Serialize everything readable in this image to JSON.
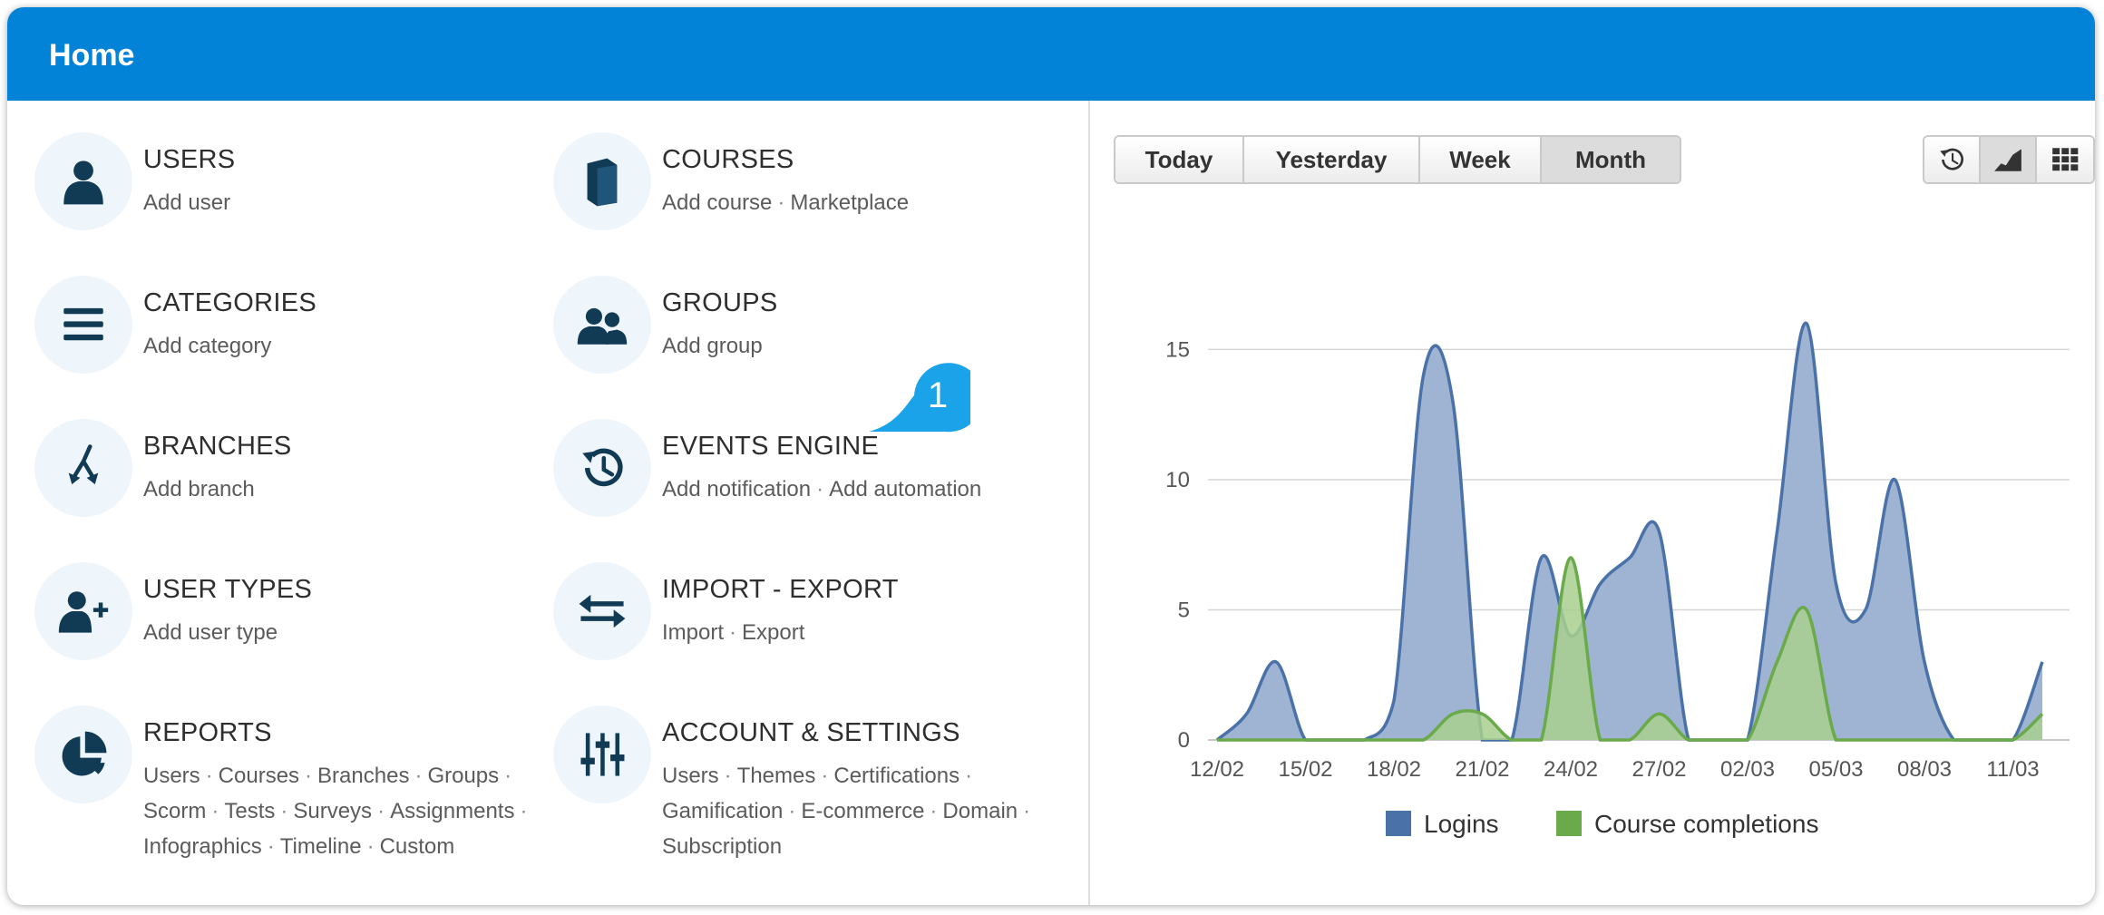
{
  "header": {
    "title": "Home"
  },
  "menu": [
    {
      "id": "users",
      "icon": "user-icon",
      "title": "USERS",
      "links": [
        [
          "Add user"
        ]
      ]
    },
    {
      "id": "courses",
      "icon": "book-icon",
      "title": "COURSES",
      "links": [
        [
          "Add course",
          "Marketplace"
        ]
      ]
    },
    {
      "id": "categories",
      "icon": "list-icon",
      "title": "CATEGORIES",
      "links": [
        [
          "Add category"
        ]
      ]
    },
    {
      "id": "groups",
      "icon": "group-icon",
      "title": "GROUPS",
      "links": [
        [
          "Add group"
        ]
      ]
    },
    {
      "id": "branches",
      "icon": "branch-icon",
      "title": "BRANCHES",
      "links": [
        [
          "Add branch"
        ]
      ]
    },
    {
      "id": "events-engine",
      "icon": "history-icon",
      "title": "EVENTS ENGINE",
      "links": [
        [
          "Add notification",
          "Add automation"
        ]
      ]
    },
    {
      "id": "user-types",
      "icon": "add-user-icon",
      "title": "USER TYPES",
      "links": [
        [
          "Add user type"
        ]
      ]
    },
    {
      "id": "import-export",
      "icon": "swap-arrows-icon",
      "title": "IMPORT - EXPORT",
      "links": [
        [
          "Import",
          "Export"
        ]
      ]
    },
    {
      "id": "reports",
      "icon": "pie-chart-icon",
      "title": "REPORTS",
      "links": [
        [
          "Users",
          "Courses",
          "Branches",
          "Groups",
          ""
        ],
        [
          "Scorm",
          "Tests",
          "Surveys",
          "Assignments",
          ""
        ],
        [
          "Infographics",
          "Timeline",
          "Custom"
        ]
      ]
    },
    {
      "id": "account-settings",
      "icon": "sliders-icon",
      "title": "ACCOUNT & SETTINGS",
      "links": [
        [
          "Users",
          "Themes",
          "Certifications",
          ""
        ],
        [
          "Gamification",
          "E-commerce",
          "Domain",
          ""
        ],
        [
          "Subscription"
        ]
      ]
    }
  ],
  "callout": {
    "number": "1",
    "color": "#1aa3e8"
  },
  "period_tabs": {
    "items": [
      "Today",
      "Yesterday",
      "Week",
      "Month"
    ],
    "active": "Month"
  },
  "view_buttons": {
    "items": [
      "timeline-icon",
      "area-chart-icon",
      "grid-icon"
    ],
    "active": "area-chart-icon"
  },
  "chart_data": {
    "type": "area",
    "x": [
      "12/02",
      "13/02",
      "14/02",
      "15/02",
      "16/02",
      "17/02",
      "18/02",
      "19/02",
      "20/02",
      "21/02",
      "22/02",
      "23/02",
      "24/02",
      "25/02",
      "26/02",
      "27/02",
      "28/02",
      "01/03",
      "02/03",
      "03/03",
      "04/03",
      "05/03",
      "06/03",
      "07/03",
      "08/03",
      "09/03",
      "10/03",
      "11/03",
      "12/03"
    ],
    "xticks": [
      "12/02",
      "15/02",
      "18/02",
      "21/02",
      "24/02",
      "27/02",
      "02/03",
      "05/03",
      "08/03",
      "11/03"
    ],
    "yticks": [
      0,
      5,
      10,
      15
    ],
    "ylim": [
      0,
      17
    ],
    "grid": true,
    "legend": "bottom",
    "series": [
      {
        "name": "Logins",
        "color": "#4a72a8",
        "fill": "#9fb3d3",
        "values": [
          0,
          1,
          3,
          0,
          0,
          0,
          1.5,
          14,
          13,
          0,
          0,
          7,
          4,
          6,
          7,
          8,
          0,
          0,
          0,
          8,
          16,
          6,
          5,
          10,
          3,
          0,
          0,
          0,
          3
        ]
      },
      {
        "name": "Course completions",
        "color": "#6aaa4a",
        "fill": "#a8cf8e",
        "values": [
          0,
          0,
          0,
          0,
          0,
          0,
          0,
          0,
          1,
          1,
          0,
          0,
          7,
          0,
          0,
          1,
          0,
          0,
          0,
          3,
          5,
          0,
          0,
          0,
          0,
          0,
          0,
          0,
          1
        ]
      }
    ]
  }
}
